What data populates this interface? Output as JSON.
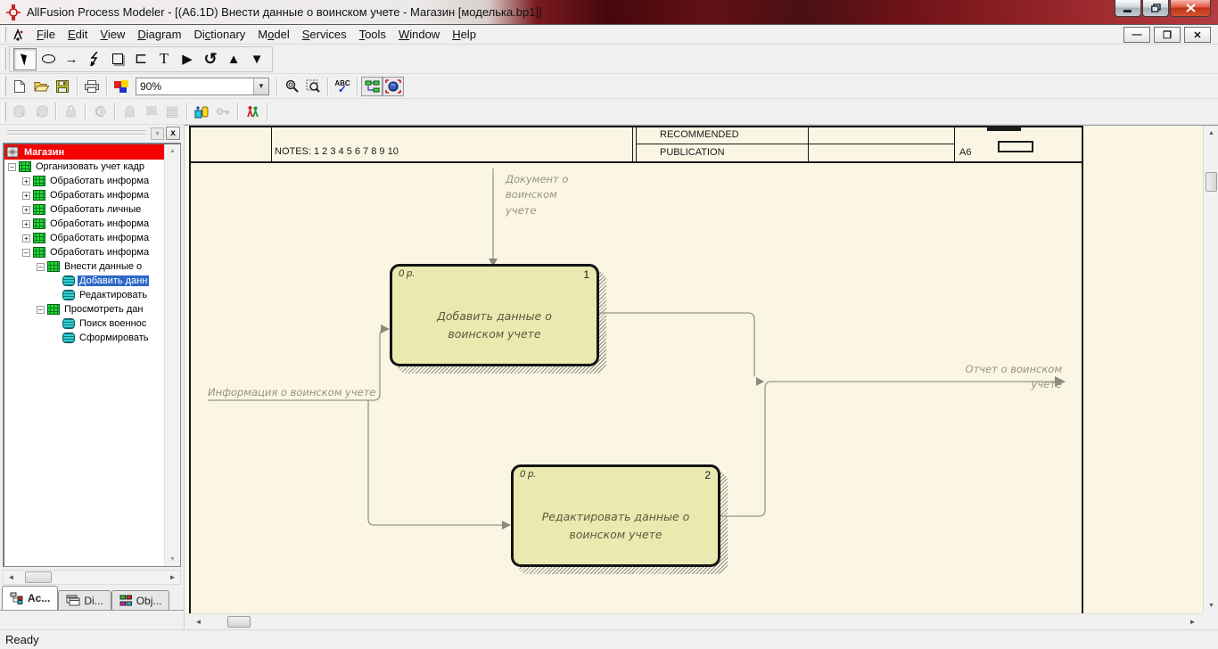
{
  "window": {
    "title": "AllFusion Process Modeler - [(А6.1D) Внести данные о воинском учете - Магазин  [моделька.bp1]]",
    "controls": {
      "minimize": "—",
      "restore": "❐",
      "close": "✕"
    }
  },
  "menu": {
    "items": [
      {
        "label": "File",
        "u": 0
      },
      {
        "label": "Edit",
        "u": 0
      },
      {
        "label": "View",
        "u": 0
      },
      {
        "label": "Diagram",
        "u": 0
      },
      {
        "label": "Dictionary",
        "u": 2
      },
      {
        "label": "Model",
        "u": 1
      },
      {
        "label": "Services",
        "u": 0
      },
      {
        "label": "Tools",
        "u": 0
      },
      {
        "label": "Window",
        "u": 0
      },
      {
        "label": "Help",
        "u": 0
      }
    ]
  },
  "icons": {
    "ellipse": "",
    "arrow": "→",
    "square": "",
    "open_rect": "⊏",
    "text_tool": "T",
    "play": "▶",
    "rotate": "↺",
    "tri_up": "▲",
    "tri_down": "▼",
    "combo_arrow": "▼",
    "abc": "ABC",
    "check": "✓",
    "grid": "▦",
    "scroll_up": "▲",
    "scroll_down": "▼",
    "scroll_left": "◄",
    "scroll_right": "►",
    "pane_drop": "▼",
    "pane_close": "x",
    "mdi_min": "—",
    "mdi_restore": "❐",
    "mdi_close": "✕",
    "expand_plus": "+",
    "expand_minus": "–"
  },
  "toolbar_standard": {
    "zoom_value": "90%"
  },
  "sidebar": {
    "model": {
      "label": "Магазин"
    },
    "tree": [
      {
        "label": "Организовать учет кадр",
        "level": 1,
        "expand": "minus",
        "icon": "green",
        "selected": false
      },
      {
        "label": "Обработать информа",
        "level": 2,
        "expand": "plus",
        "icon": "green",
        "selected": false
      },
      {
        "label": "Обработать информа",
        "level": 2,
        "expand": "plus",
        "icon": "green",
        "selected": false
      },
      {
        "label": "Обработать  личные ",
        "level": 2,
        "expand": "plus",
        "icon": "green",
        "selected": false
      },
      {
        "label": "Обработать информа",
        "level": 2,
        "expand": "plus",
        "icon": "green",
        "selected": false
      },
      {
        "label": "Обработать информа",
        "level": 2,
        "expand": "plus",
        "icon": "green",
        "selected": false
      },
      {
        "label": "Обработать информа",
        "level": 2,
        "expand": "minus",
        "icon": "green",
        "selected": false
      },
      {
        "label": "Внести данные о ",
        "level": 3,
        "expand": "minus",
        "icon": "green",
        "selected": false
      },
      {
        "label": "Добавить данн",
        "level": 4,
        "expand": "none",
        "icon": "cyan",
        "selected": true
      },
      {
        "label": "Редактировать",
        "level": 4,
        "expand": "none",
        "icon": "cyan",
        "selected": false
      },
      {
        "label": "Просмотреть дан",
        "level": 3,
        "expand": "minus",
        "icon": "green",
        "selected": false
      },
      {
        "label": "Поиск военнос",
        "level": 4,
        "expand": "none",
        "icon": "cyan",
        "selected": false
      },
      {
        "label": "Сформировать",
        "level": 4,
        "expand": "none",
        "icon": "cyan",
        "selected": false
      }
    ],
    "tabs": [
      {
        "label": "Ac..."
      },
      {
        "label": "Di..."
      },
      {
        "label": "Obj..."
      }
    ]
  },
  "diagram": {
    "kit_header": {
      "notes": "NOTES:  1  2  3  4  5  6  7  8  9  10",
      "recommended": "RECOMMENDED",
      "publication": "PUBLICATION",
      "page": "A6"
    },
    "boxes": [
      {
        "cost": "0 р.",
        "number": "1",
        "label": "Добавить данные о воинском учете"
      },
      {
        "cost": "0 р.",
        "number": "2",
        "label": "Редактировать данные о воинском учете"
      }
    ],
    "arrows": [
      {
        "label": "Документ о воинском учете"
      },
      {
        "label": "Информация о воинском учете"
      },
      {
        "label": "Отчет о воинском учете"
      }
    ]
  },
  "status_bar": {
    "text": "Ready"
  }
}
